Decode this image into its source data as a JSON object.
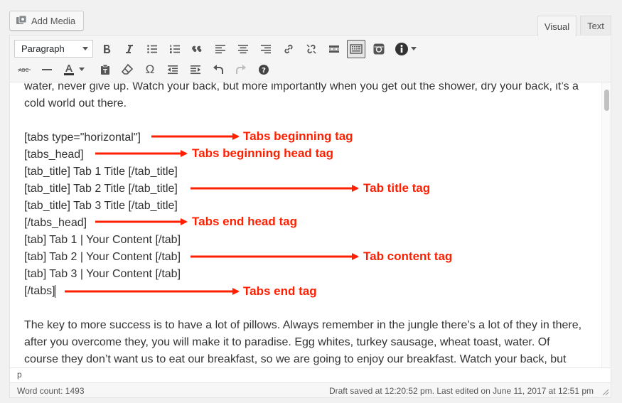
{
  "add_media": {
    "label": "Add Media",
    "icon": "media-icon"
  },
  "mode_tabs": {
    "visual": "Visual",
    "text": "Text"
  },
  "toolbar": {
    "format_select": "Paragraph",
    "row1_icons": [
      "bold-icon",
      "italic-icon",
      "bullet-list-icon",
      "numbered-list-icon",
      "blockquote-icon",
      "align-left-icon",
      "align-center-icon",
      "align-right-icon",
      "link-icon",
      "unlink-icon",
      "read-more-icon",
      "toolbar-toggle-icon",
      "instagram-icon",
      "info-icon"
    ],
    "row2_icons": [
      "strikethrough-icon",
      "horizontal-line-icon",
      "text-color-icon",
      "paste-text-icon",
      "clear-formatting-icon",
      "special-character-icon",
      "outdent-icon",
      "indent-icon",
      "undo-icon",
      "redo-icon",
      "help-icon"
    ]
  },
  "content": {
    "para1_line1": "water, never give up. Watch your back, but more importantly when you get out the shower, dry your back, it’s a",
    "para1_line2": "cold world out there.",
    "code_lines": [
      "[tabs type=\"horizontal\"]",
      "[tabs_head]",
      "[tab_title] Tab 1 Title [/tab_title]",
      "[tab_title] Tab 2 Title [/tab_title]",
      "[tab_title] Tab 3 Title [/tab_title]",
      "[/tabs_head]",
      "[tab] Tab 1 | Your Content [/tab]",
      "[tab] Tab 2 | Your Content [/tab]",
      "[tab] Tab 3 | Your Content [/tab]",
      "[/tabs]"
    ],
    "para2_lines": [
      "The key to more success is to have a lot of pillows. Always remember in the jungle there’s a lot of they in there,",
      "after you overcome they, you will make it to paradise. Egg whites, turkey sausage, wheat toast, water. Of",
      "course they don’t want us to eat our breakfast, so we are going to enjoy our breakfast. Watch your back, but"
    ]
  },
  "annotations": {
    "tabs_beginning": "Tabs beginning tag",
    "tabs_beginning_head": "Tabs beginning head tag",
    "tab_title": "Tab title tag",
    "tabs_end_head": "Tabs end head tag",
    "tab_content": "Tab content tag",
    "tabs_end": "Tabs end tag",
    "color": "#ff1f00"
  },
  "path_bar": {
    "element": "p"
  },
  "status": {
    "word_count": "Word count: 1493",
    "draft_saved": "Draft saved at 12:20:52 pm. Last edited on June 11, 2017 at 12:51 pm"
  }
}
